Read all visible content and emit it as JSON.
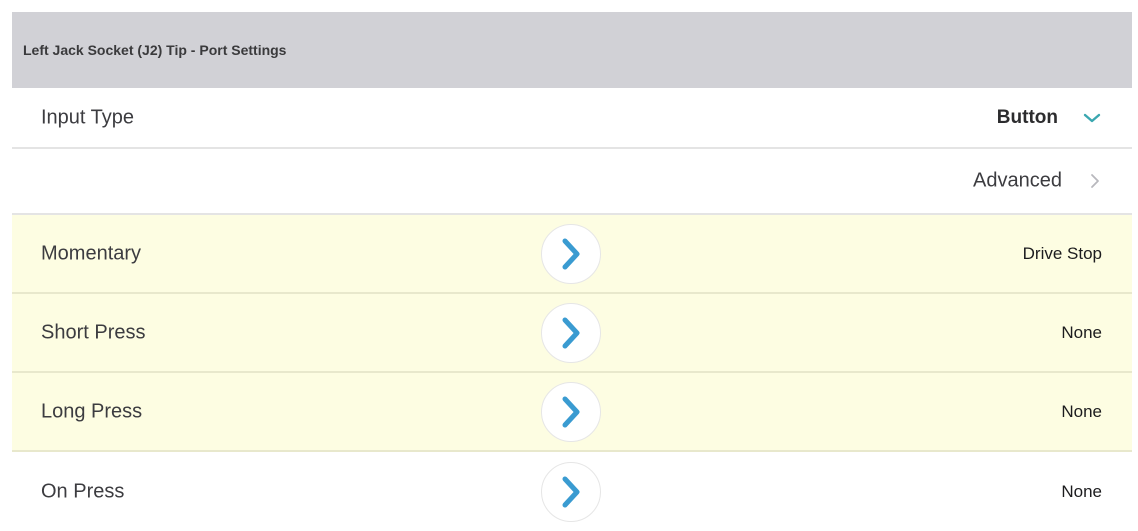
{
  "section": {
    "title": "Left Jack Socket (J2) Tip - Port Settings"
  },
  "input_type": {
    "label": "Input Type",
    "value": "Button",
    "icon": "chevron-down-icon"
  },
  "advanced": {
    "label": "Advanced",
    "icon": "chevron-right-icon"
  },
  "actions": [
    {
      "label": "Momentary",
      "value": "Drive Stop",
      "highlighted": true
    },
    {
      "label": "Short Press",
      "value": "None",
      "highlighted": true
    },
    {
      "label": "Long Press",
      "value": "None",
      "highlighted": true
    },
    {
      "label": "On Press",
      "value": "None",
      "highlighted": false
    }
  ],
  "colors": {
    "accent": "#3a9bd1",
    "highlight_row": "#fdfde2",
    "header_bg": "#d1d1d6",
    "dropdown_chevron": "#3aa7b0"
  }
}
